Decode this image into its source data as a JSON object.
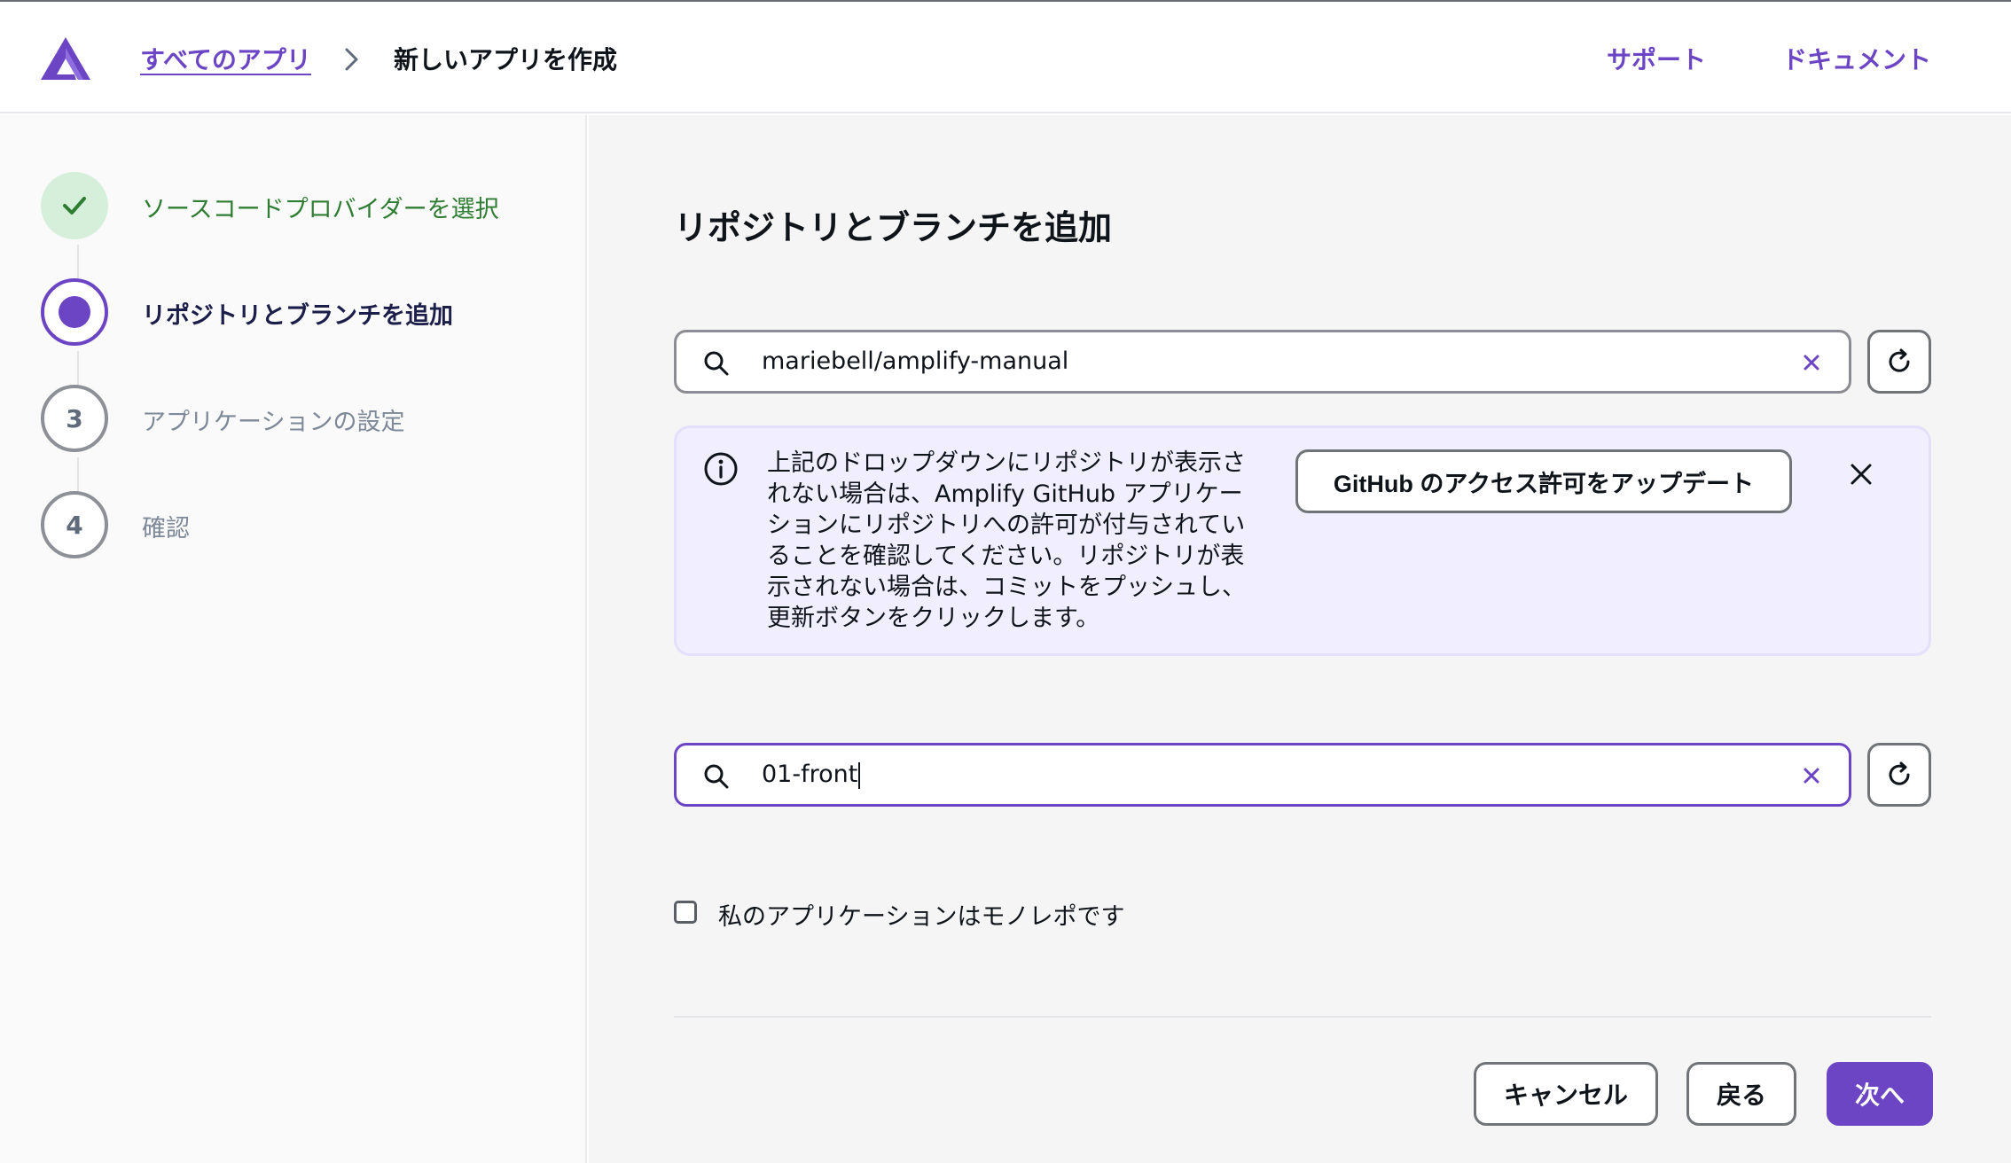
{
  "header": {
    "breadcrumb_root": "すべてのアプリ",
    "breadcrumb_current": "新しいアプリを作成",
    "support_link": "サポート",
    "docs_link": "ドキュメント"
  },
  "steps": [
    {
      "number": "1",
      "label": "ソースコードプロバイダーを選択",
      "state": "complete"
    },
    {
      "number": "2",
      "label": "リポジトリとブランチを追加",
      "state": "current"
    },
    {
      "number": "3",
      "label": "アプリケーションの設定",
      "state": "pending"
    },
    {
      "number": "4",
      "label": "確認",
      "state": "pending"
    }
  ],
  "main": {
    "title": "リポジトリとブランチを追加",
    "repository_value": "mariebell/amplify-manual",
    "branch_value": "01-front",
    "alert": {
      "text": "上記のドロップダウンにリポジトリが表示されない場合は、Amplify GitHub アプリケーションにリポジトリへの許可が付与されていることを確認してください。リポジトリが表示されない場合は、コミットをプッシュし、更新ボタンをクリックします。",
      "button_label": "GitHub のアクセス許可をアップデート"
    },
    "monorepo_label": "私のアプリケーションはモノレポです",
    "monorepo_checked": false
  },
  "actions": {
    "cancel_label": "キャンセル",
    "back_label": "戻る",
    "next_label": "次へ"
  },
  "colors": {
    "accent": "#6c45c4",
    "success_bg": "#d5efdb",
    "success_text": "#2e7d32",
    "alert_bg": "#f1efff"
  },
  "icons": {
    "logo": "amplify-logo-icon",
    "search": "search-icon",
    "clear": "clear-icon",
    "refresh": "refresh-icon",
    "info": "info-icon",
    "close": "close-icon",
    "check": "check-icon",
    "chevron": "chevron-right-icon"
  }
}
